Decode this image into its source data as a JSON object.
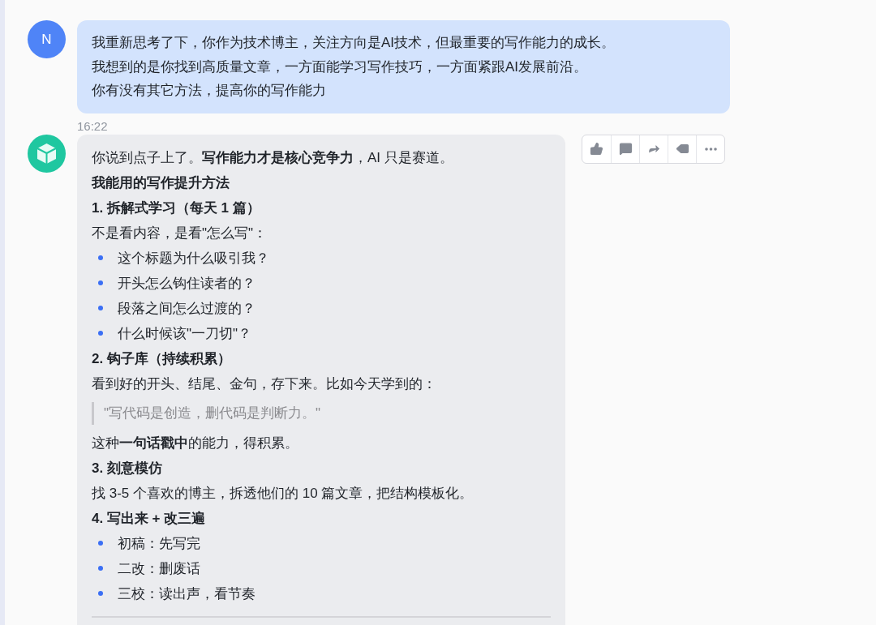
{
  "messages": [
    {
      "kind": "user",
      "avatar": "N",
      "lines": [
        "我重新思考了下，你作为技术博主，关注方向是AI技术，但最重要的写作能力的成长。",
        "我想到的是你找到高质量文章，一方面能学习写作技巧，一方面紧跟AI发展前沿。",
        "你有没有其它方法，提高你的写作能力"
      ]
    },
    {
      "kind": "assistant",
      "time": "16:22",
      "blocks": [
        {
          "kind": "paragraph",
          "text": "你说到点子上了。**写作能力才是核心竞争力**，AI 只是赛道。"
        },
        {
          "kind": "heading",
          "text": "我能用的写作提升方法"
        },
        {
          "kind": "heading",
          "text": "1. 拆解式学习（每天 1 篇）"
        },
        {
          "kind": "paragraph",
          "text": "不是看内容，是看\"怎么写\"："
        },
        {
          "kind": "bullets",
          "items": [
            "这个标题为什么吸引我？",
            "开头怎么钩住读者的？",
            "段落之间怎么过渡的？",
            "什么时候该\"一刀切\"？"
          ]
        },
        {
          "kind": "heading",
          "text": "2. 钩子库（持续积累）"
        },
        {
          "kind": "paragraph",
          "text": "看到好的开头、结尾、金句，存下来。比如今天学到的："
        },
        {
          "kind": "quote",
          "text": "\"写代码是创造，删代码是判断力。\""
        },
        {
          "kind": "paragraph",
          "text": "这种**一句话戳中**的能力，得积累。"
        },
        {
          "kind": "heading",
          "text": "3. 刻意模仿"
        },
        {
          "kind": "paragraph",
          "text": "找 3-5 个喜欢的博主，拆透他们的 10 篇文章，把结构模板化。"
        },
        {
          "kind": "heading",
          "text": "4. 写出来 + 改三遍"
        },
        {
          "kind": "bullets",
          "items": [
            "初稿：先写完",
            "二改：删废话",
            "三校：读出声，看节奏"
          ]
        },
        {
          "kind": "divider"
        }
      ],
      "actions": [
        {
          "kind": "like"
        },
        {
          "kind": "comment"
        },
        {
          "kind": "share"
        },
        {
          "kind": "quote"
        },
        {
          "kind": "more"
        }
      ]
    }
  ]
}
